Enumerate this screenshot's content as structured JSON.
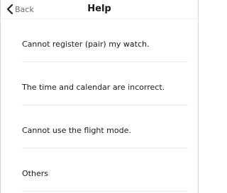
{
  "header": {
    "back_label": "Back",
    "title": "Help"
  },
  "help_items": [
    {
      "label": "Cannot register (pair) my watch."
    },
    {
      "label": "The time and calendar are incorrect."
    },
    {
      "label": "Cannot use the flight mode."
    },
    {
      "label": "Others"
    }
  ],
  "icons": {
    "back": "chevron-left-icon"
  },
  "colors": {
    "background": "#ffffff",
    "text": "#1a1a1a",
    "back_text": "#6b6b6b",
    "divider": "#ececec"
  }
}
